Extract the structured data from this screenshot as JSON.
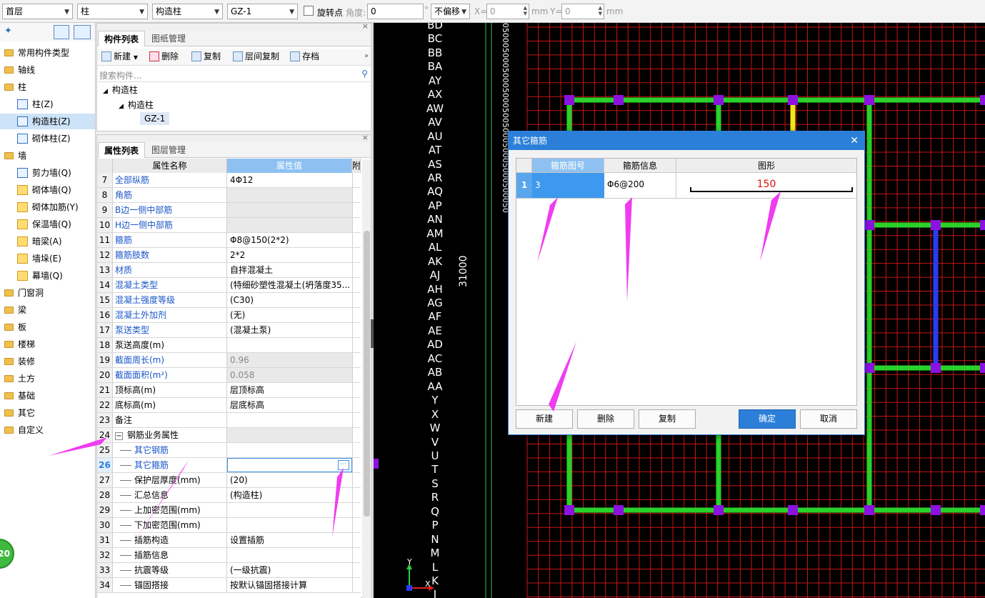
{
  "toolbar": {
    "floor": "首层",
    "category": "柱",
    "type": "构造柱",
    "component": "GZ-1",
    "rotate_label": "旋转点",
    "angle_label": "角度:",
    "angle_value": "0",
    "degree": "°",
    "offset": "不偏移",
    "x_label": "X=",
    "x_value": "0",
    "mm1": "mm",
    "y_label": "Y=",
    "y_value": "0",
    "mm2": "mm"
  },
  "nav": {
    "items": [
      {
        "label": "常用构件类型",
        "kind": "folder"
      },
      {
        "label": "轴线",
        "kind": "folder"
      },
      {
        "label": "柱",
        "kind": "folder"
      },
      {
        "label": "柱(Z)",
        "kind": "sub"
      },
      {
        "label": "构造柱(Z)",
        "kind": "sub",
        "selected": true
      },
      {
        "label": "砌体柱(Z)",
        "kind": "sub"
      },
      {
        "label": "墙",
        "kind": "folder"
      },
      {
        "label": "剪力墙(Q)",
        "kind": "sub"
      },
      {
        "label": "砌体墙(Q)",
        "kind": "sub"
      },
      {
        "label": "砌体加筋(Y)",
        "kind": "sub"
      },
      {
        "label": "保温墙(Q)",
        "kind": "sub"
      },
      {
        "label": "暗梁(A)",
        "kind": "sub"
      },
      {
        "label": "墙垛(E)",
        "kind": "sub"
      },
      {
        "label": "幕墙(Q)",
        "kind": "sub"
      },
      {
        "label": "门窗洞",
        "kind": "folder"
      },
      {
        "label": "梁",
        "kind": "folder"
      },
      {
        "label": "板",
        "kind": "folder"
      },
      {
        "label": "楼梯",
        "kind": "folder"
      },
      {
        "label": "装修",
        "kind": "folder"
      },
      {
        "label": "土方",
        "kind": "folder"
      },
      {
        "label": "基础",
        "kind": "folder"
      },
      {
        "label": "其它",
        "kind": "folder"
      },
      {
        "label": "自定义",
        "kind": "folder"
      }
    ],
    "badge": "20"
  },
  "component_panel": {
    "tab_active": "构件列表",
    "tab_other": "图纸管理",
    "btn_new": "新建",
    "btn_delete": "删除",
    "btn_copy": "复制",
    "btn_floor_copy": "层间复制",
    "btn_save": "存档",
    "search_placeholder": "搜索构件...",
    "tree_root": "构造柱",
    "tree_child": "构造柱",
    "tree_leaf": "GZ-1"
  },
  "prop_panel": {
    "tab_active": "属性列表",
    "tab_other": "图层管理",
    "col_name": "属性名称",
    "col_value": "属性值",
    "col_extra": "附",
    "rows": [
      {
        "n": "7",
        "name": "全部纵筋",
        "value": "4Φ12",
        "blue": true
      },
      {
        "n": "8",
        "name": "角筋",
        "value": "",
        "blue": true,
        "dis": true
      },
      {
        "n": "9",
        "name": "B边一侧中部筋",
        "value": "",
        "blue": true,
        "dis": true
      },
      {
        "n": "10",
        "name": "H边一侧中部筋",
        "value": "",
        "blue": true,
        "dis": true
      },
      {
        "n": "11",
        "name": "箍筋",
        "value": "Φ8@150(2*2)",
        "blue": true
      },
      {
        "n": "12",
        "name": "箍筋肢数",
        "value": "2*2",
        "blue": true
      },
      {
        "n": "13",
        "name": "材质",
        "value": "自拌混凝土",
        "blue": true
      },
      {
        "n": "14",
        "name": "混凝土类型",
        "value": "(特细砂塑性混凝土(坍落度35...",
        "blue": true
      },
      {
        "n": "15",
        "name": "混凝土强度等级",
        "value": "(C30)",
        "blue": true
      },
      {
        "n": "16",
        "name": "混凝土外加剂",
        "value": "(无)",
        "blue": true
      },
      {
        "n": "17",
        "name": "泵送类型",
        "value": "(混凝土泵)",
        "blue": true
      },
      {
        "n": "18",
        "name": "泵送高度(m)",
        "value": ""
      },
      {
        "n": "19",
        "name": "截面周长(m)",
        "value": "0.96",
        "blue": true,
        "dis": true
      },
      {
        "n": "20",
        "name": "截面面积(m²)",
        "value": "0.058",
        "blue": true,
        "dis": true
      },
      {
        "n": "21",
        "name": "顶标高(m)",
        "value": "层顶标高"
      },
      {
        "n": "22",
        "name": "底标高(m)",
        "value": "层底标高"
      },
      {
        "n": "23",
        "name": "备注",
        "value": ""
      },
      {
        "n": "24",
        "name": "钢筋业务属性",
        "value": "",
        "group": true,
        "dis": true
      },
      {
        "n": "25",
        "name": "其它钢筋",
        "value": "",
        "blue": true,
        "indent": true
      },
      {
        "n": "26",
        "name": "其它箍筋",
        "value": "",
        "blue": true,
        "indent": true,
        "active": true
      },
      {
        "n": "27",
        "name": "保护层厚度(mm)",
        "value": "(20)",
        "indent": true
      },
      {
        "n": "28",
        "name": "汇总信息",
        "value": "(构造柱)",
        "indent": true
      },
      {
        "n": "29",
        "name": "上加密范围(mm)",
        "value": "",
        "indent": true
      },
      {
        "n": "30",
        "name": "下加密范围(mm)",
        "value": "",
        "indent": true
      },
      {
        "n": "31",
        "name": "插筋构造",
        "value": "设置插筋",
        "indent": true
      },
      {
        "n": "32",
        "name": "插筋信息",
        "value": "",
        "indent": true
      },
      {
        "n": "33",
        "name": "抗震等级",
        "value": "(一级抗震)",
        "indent": true
      },
      {
        "n": "34",
        "name": "锚固搭接",
        "value": "按默认锚固搭接计算",
        "indent": true
      }
    ],
    "ellipsis": "···"
  },
  "cad": {
    "axis_labels": [
      "BD",
      "BC",
      "BB",
      "BA",
      "AY",
      "AX",
      "AW",
      "AV",
      "AU",
      "AT",
      "AS",
      "AR",
      "AQ",
      "AP",
      "AN",
      "AM",
      "AL",
      "AK",
      "AJ",
      "AH",
      "AG",
      "AF",
      "AE",
      "AD",
      "AC",
      "AB",
      "AA",
      "Y",
      "X",
      "W",
      "V",
      "U",
      "T",
      "S",
      "R",
      "Q",
      "P",
      "N",
      "M",
      "L",
      "K",
      "J"
    ],
    "dimension": "31000",
    "dim_strip": "0500050005000500050",
    "coord_y": "Y",
    "coord_x": "X"
  },
  "dialog": {
    "title": "其它箍筋",
    "col_figure_no": "箍筋图号",
    "col_info": "箍筋信息",
    "col_shape": "图形",
    "row_index": "1",
    "row_figure_no": "3",
    "row_info": "Φ6@200",
    "row_shape_value": "150",
    "btn_new": "新建",
    "btn_delete": "删除",
    "btn_copy": "复制",
    "btn_ok": "确定",
    "btn_cancel": "取消"
  },
  "colors": {
    "accent": "#2b7fd8",
    "cad_grid": "#c81414",
    "wall_green": "#29d22a",
    "column_purple": "#8b12e0",
    "annotation_arrow": "#f03cf0"
  }
}
